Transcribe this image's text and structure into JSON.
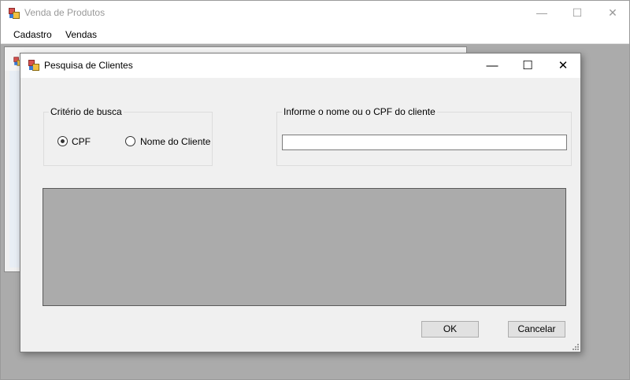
{
  "main_window": {
    "title": "Venda de Produtos",
    "menu": [
      "Cadastro",
      "Vendas"
    ],
    "controls": {
      "minimize": "—",
      "maximize": "☐",
      "close": "✕"
    }
  },
  "dialog": {
    "title": "Pesquisa de Clientes",
    "controls": {
      "minimize": "—",
      "maximize": "☐",
      "close": "✕"
    },
    "search_criteria": {
      "legend": "Critério de busca",
      "options": [
        {
          "label": "CPF",
          "selected": true
        },
        {
          "label": "Nome do Cliente",
          "selected": false
        }
      ]
    },
    "search_field": {
      "legend": "Informe o nome ou o CPF do cliente",
      "value": "",
      "placeholder": ""
    },
    "buttons": {
      "ok": "OK",
      "cancel": "Cancelar"
    }
  },
  "colors": {
    "mdi_background": "#ababab",
    "dialog_background": "#f0f0f0",
    "grid_background": "#ababab"
  }
}
